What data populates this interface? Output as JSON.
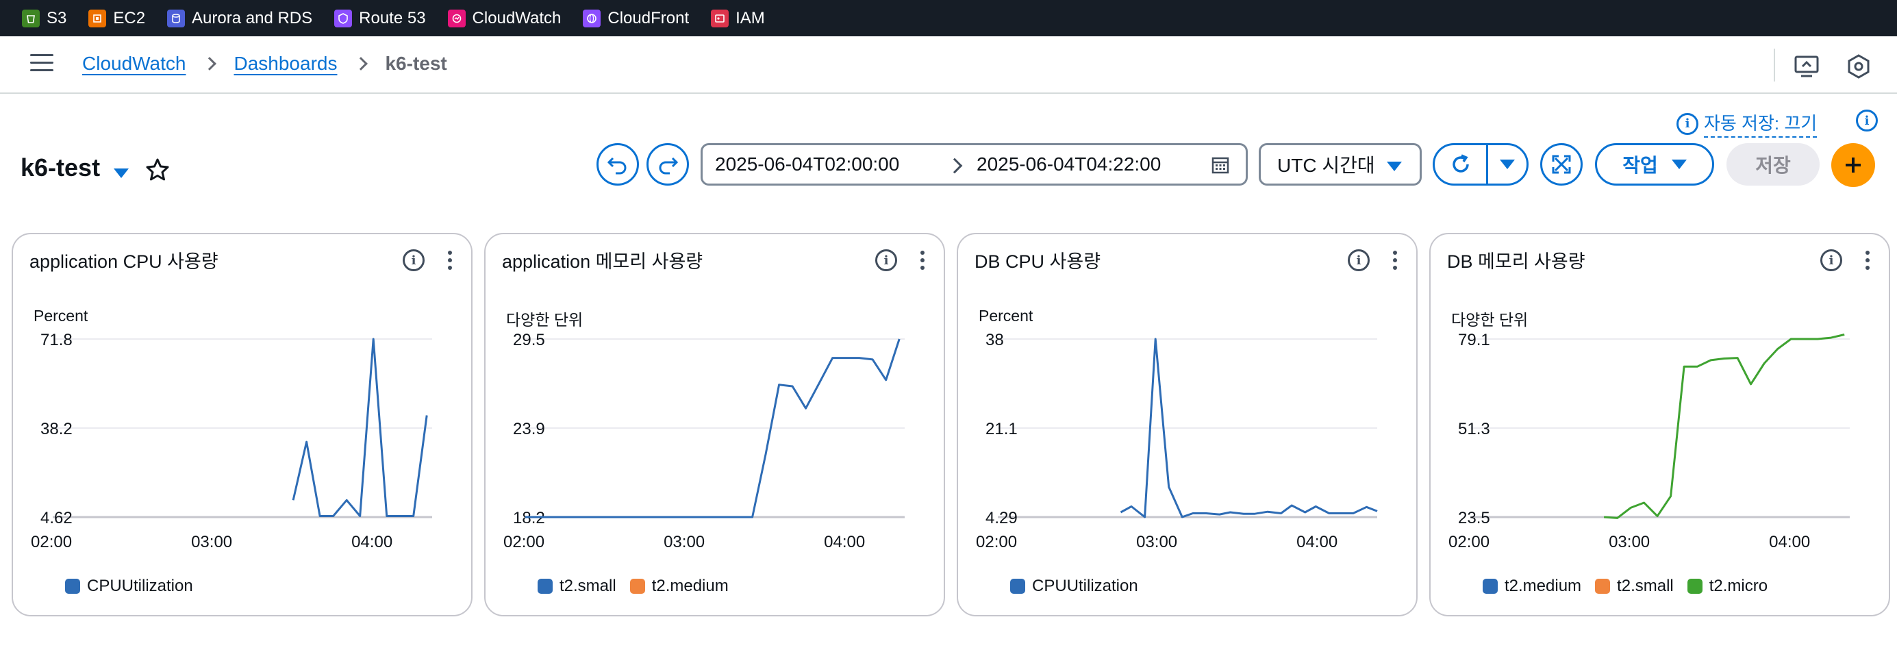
{
  "services": [
    {
      "label": "S3",
      "color": "#3f8624",
      "icon": "bucket-icon"
    },
    {
      "label": "EC2",
      "color": "#ed7100",
      "icon": "chip-icon"
    },
    {
      "label": "Aurora and RDS",
      "color": "#4d5fd8",
      "icon": "database-icon"
    },
    {
      "label": "Route 53",
      "color": "#8c4fff",
      "icon": "shield-icon"
    },
    {
      "label": "CloudWatch",
      "color": "#e7157b",
      "icon": "monitor-icon"
    },
    {
      "label": "CloudFront",
      "color": "#8c4fff",
      "icon": "globe-icon"
    },
    {
      "label": "IAM",
      "color": "#dd344c",
      "icon": "id-card-icon"
    }
  ],
  "breadcrumb": {
    "items": [
      "CloudWatch",
      "Dashboards"
    ],
    "current": "k6-test"
  },
  "autosave": "자동 저장: 끄기",
  "dashboard": {
    "title": "k6-test"
  },
  "timerange": {
    "from": "2025-06-04T02:00:00",
    "to": "2025-06-04T04:22:00"
  },
  "timezone": "UTC 시간대",
  "actions_label": "작업",
  "save_label": "저장",
  "colors": {
    "blue": "#2e6cb5",
    "orange": "#f0843d",
    "green": "#3fa331",
    "accent": "#0972d3",
    "plus": "#ff9900"
  },
  "widgets": [
    {
      "title": "application CPU 사용량",
      "unit": "Percent",
      "legend": [
        {
          "name": "CPUUtilization",
          "color": "#2e6cb5"
        }
      ],
      "chart_data": {
        "type": "line",
        "xticks": [
          "02:00",
          "03:00",
          "04:00"
        ],
        "yticks": [
          "71.8",
          "38.2",
          "4.62"
        ],
        "ylim": [
          4.62,
          71.8
        ],
        "xlim_minutes": [
          0,
          142
        ],
        "series": [
          {
            "name": "CPUUtilization",
            "color": "#2e6cb5",
            "x_minutes": [
              90,
              95,
              100,
              105,
              110,
              115,
              120,
              125,
              130,
              135,
              140
            ],
            "values": [
              11,
              33,
              5,
              5,
              11,
              5,
              71.8,
              5,
              5,
              5,
              43
            ]
          }
        ]
      }
    },
    {
      "title": "application 메모리 사용량",
      "unit": "다양한 단위",
      "legend": [
        {
          "name": "t2.small",
          "color": "#2e6cb5"
        },
        {
          "name": "t2.medium",
          "color": "#f0843d"
        }
      ],
      "chart_data": {
        "type": "line",
        "xticks": [
          "02:00",
          "03:00",
          "04:00"
        ],
        "yticks": [
          "29.5",
          "23.9",
          "18.2"
        ],
        "ylim": [
          18.2,
          29.5
        ],
        "xlim_minutes": [
          0,
          142
        ],
        "series": [
          {
            "name": "t2.small",
            "color": "#2e6cb5",
            "x_minutes": [
              0,
              85,
              90,
              95,
              100,
              105,
              110,
              115,
              120,
              125,
              130,
              135,
              140
            ],
            "values": [
              18.2,
              18.2,
              22.2,
              26.6,
              26.5,
              25.1,
              26.7,
              28.3,
              28.3,
              28.3,
              28.2,
              26.9,
              29.5
            ]
          }
        ]
      }
    },
    {
      "title": "DB CPU 사용량",
      "unit": "Percent",
      "legend": [
        {
          "name": "CPUUtilization",
          "color": "#2e6cb5"
        }
      ],
      "chart_data": {
        "type": "line",
        "xticks": [
          "02:00",
          "03:00",
          "04:00"
        ],
        "yticks": [
          "38",
          "21.1",
          "4.29"
        ],
        "ylim": [
          4.29,
          38
        ],
        "xlim_minutes": [
          0,
          142
        ],
        "series": [
          {
            "name": "CPUUtilization",
            "color": "#2e6cb5",
            "x_minutes": [
              46,
              50,
              55,
              59,
              64,
              69,
              73,
              78,
              83,
              87,
              92,
              96,
              101,
              106,
              110,
              115,
              119,
              124,
              129,
              133,
              138,
              142
            ],
            "values": [
              5.2,
              6.3,
              4.3,
              38,
              10,
              4.3,
              5,
              5,
              4.8,
              5.2,
              4.9,
              4.9,
              5.3,
              5,
              6.5,
              5.2,
              6.3,
              5,
              5,
              5,
              6.2,
              5.4
            ]
          }
        ]
      }
    },
    {
      "title": "DB 메모리 사용량",
      "unit": "다양한 단위",
      "legend": [
        {
          "name": "t2.medium",
          "color": "#2e6cb5"
        },
        {
          "name": "t2.small",
          "color": "#f0843d"
        },
        {
          "name": "t2.micro",
          "color": "#3fa331"
        }
      ],
      "chart_data": {
        "type": "line",
        "xticks": [
          "02:00",
          "03:00",
          "04:00"
        ],
        "yticks": [
          "79.1",
          "51.3",
          "23.5"
        ],
        "ylim": [
          23.5,
          79.1
        ],
        "xlim_minutes": [
          0,
          142
        ],
        "series": [
          {
            "name": "t2.micro",
            "color": "#3fa331",
            "x_minutes": [
              50,
              55,
              60,
              65,
              70,
              75,
              80,
              85,
              90,
              95,
              100,
              105,
              110,
              115,
              120,
              125,
              130,
              135,
              140
            ],
            "values": [
              23.5,
              23.2,
              26.4,
              28,
              23.8,
              30,
              70.5,
              70.5,
              72.5,
              73,
              73.2,
              65,
              71.5,
              76,
              79.1,
              79.1,
              79.1,
              79.5,
              80.5
            ]
          }
        ]
      }
    }
  ]
}
